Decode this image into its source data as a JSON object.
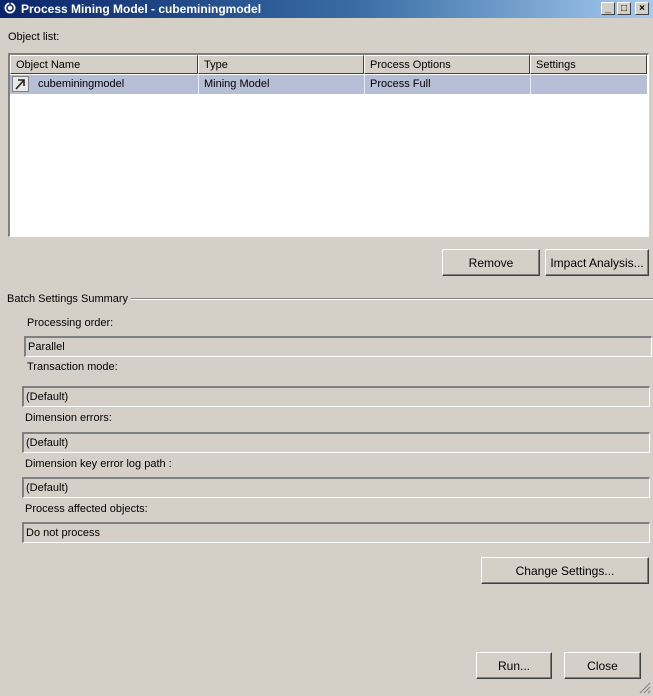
{
  "window": {
    "title": "Process Mining Model - cubeminingmodel",
    "minimize": "_",
    "maximize": "□",
    "close": "×"
  },
  "object_list": {
    "label": "Object list:",
    "columns": [
      "Object Name",
      "Type",
      "Process Options",
      "Settings"
    ],
    "rows": [
      {
        "name": "cubeminingmodel",
        "type": "Mining Model",
        "process_options": "Process Full",
        "settings": ""
      }
    ]
  },
  "buttons": {
    "remove": "Remove",
    "impact_analysis": "Impact Analysis...",
    "change_settings": "Change Settings...",
    "run": "Run...",
    "close": "Close"
  },
  "batch": {
    "title": "Batch Settings Summary",
    "processing_order_label": "Processing order:",
    "processing_order_value": "Parallel",
    "transaction_mode_label": "Transaction mode:",
    "transaction_mode_value": "(Default)",
    "dimension_errors_label": "Dimension errors:",
    "dimension_errors_value": "(Default)",
    "key_error_log_label": "Dimension key error log path :",
    "key_error_log_value": "(Default)",
    "affected_objects_label": "Process affected objects:",
    "affected_objects_value": "Do not process"
  },
  "colors": {
    "dialog_bg": "#d4d0c8",
    "title_start": "#0a246a",
    "title_end": "#a6caf0",
    "selected_row": "#b7bfd6"
  },
  "icons": {
    "title": "process-icon",
    "row": "mining-model-icon",
    "resize": "resize-grip-icon"
  }
}
